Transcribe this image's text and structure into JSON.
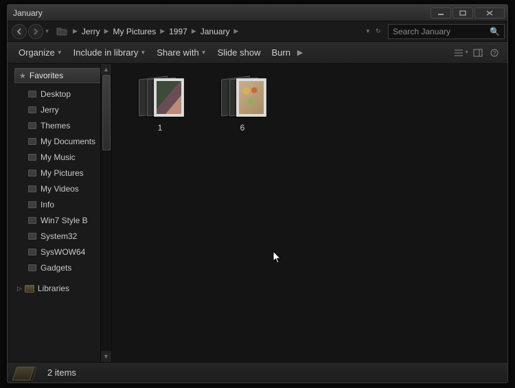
{
  "window": {
    "title": "January"
  },
  "breadcrumb": {
    "items": [
      "Jerry",
      "My Pictures",
      "1997",
      "January"
    ]
  },
  "search": {
    "placeholder": "Search January"
  },
  "toolbar": {
    "organize": "Organize",
    "include": "Include in library",
    "share": "Share with",
    "slideshow": "Slide show",
    "burn": "Burn"
  },
  "sidebar": {
    "favorites_label": "Favorites",
    "items": [
      "Desktop",
      "Jerry",
      "Themes",
      "My Documents",
      "My Music",
      "My Pictures",
      "My Videos",
      "Info",
      "Win7 Style B",
      "System32",
      "SysWOW64",
      "Gadgets"
    ],
    "libraries_label": "Libraries"
  },
  "content": {
    "folders": [
      {
        "name": "1"
      },
      {
        "name": "6"
      }
    ]
  },
  "status": {
    "text": "2 items"
  }
}
